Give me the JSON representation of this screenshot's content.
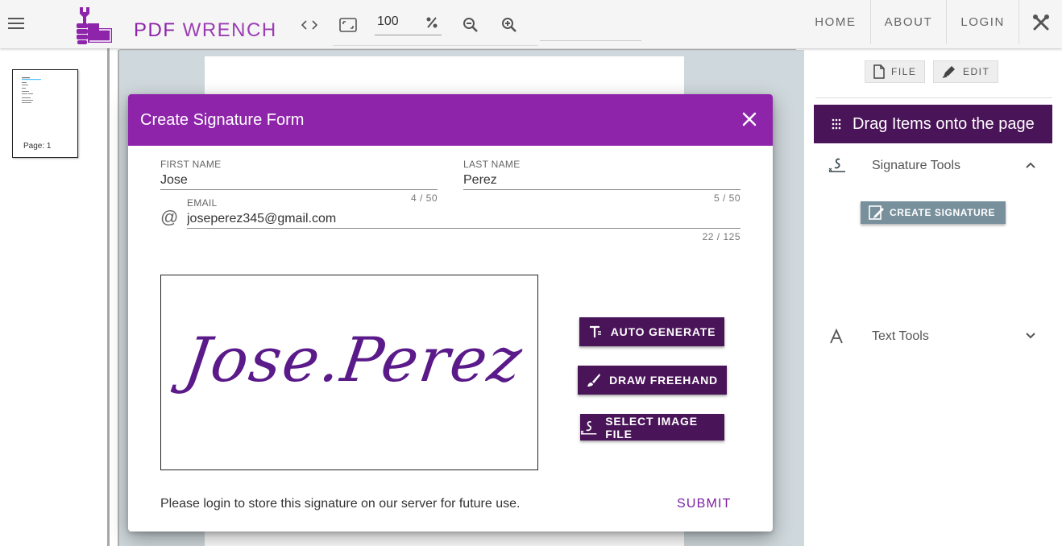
{
  "app": {
    "logo_pdf": "PDF",
    "logo_wrench": "WRENCH"
  },
  "toolbar": {
    "zoom_value": "100",
    "icons": [
      "code-icon",
      "fit-page-icon",
      "percent-icon",
      "zoom-out-icon",
      "zoom-in-icon"
    ]
  },
  "nav": {
    "links": [
      "HOME",
      "ABOUT",
      "LOGIN"
    ],
    "tools_icon": "tools-icon"
  },
  "thumbnails": [
    {
      "label": "Page: 1"
    }
  ],
  "right_panel": {
    "file_label": "FILE",
    "edit_label": "EDIT",
    "drag_header": "Drag Items onto the page",
    "sections": [
      {
        "label": "Signature Tools",
        "expanded": true,
        "buttons": [
          "CREATE SIGNATURE"
        ]
      },
      {
        "label": "Text Tools",
        "expanded": false
      }
    ]
  },
  "dialog": {
    "title": "Create Signature Form",
    "first_name": {
      "label": "FIRST NAME",
      "value": "Jose",
      "counter": "4 / 50"
    },
    "last_name": {
      "label": "LAST NAME",
      "value": "Perez",
      "counter": "5 / 50"
    },
    "email": {
      "label": "EMAIL",
      "value": "joseperez345@gmail.com",
      "counter": "22 / 125"
    },
    "signature_text": "Jose.Perez",
    "buttons": {
      "auto_generate": "AUTO GENERATE",
      "draw_freehand": "DRAW FREEHAND",
      "select_image": "SELECT IMAGE FILE"
    },
    "footer_note": "Please login to store this signature on our server for future use.",
    "submit": "SUBMIT"
  },
  "colors": {
    "primary": "#8e24aa",
    "dark_primary": "#4a1458",
    "create_signature_bg": "#78909c",
    "viewer_bg": "#cfd8dc"
  }
}
